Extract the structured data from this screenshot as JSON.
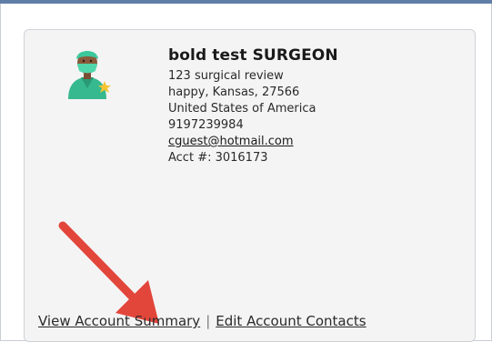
{
  "contact": {
    "name": "bold test SURGEON",
    "address": "123 surgical review",
    "city_state_zip": "happy, Kansas, 27566",
    "country": "United States of America",
    "phone": "9197239984",
    "email": "cguest@hotmail.com",
    "account": "Acct #: 3016173"
  },
  "links": {
    "view_summary": "View Account Summary",
    "separator": "|",
    "edit_contacts": "Edit Account Contacts"
  },
  "icons": {
    "avatar": "surgeon-avatar-icon",
    "annotation": "red-arrow-icon"
  },
  "colors": {
    "arrow": "#e2463a",
    "scrubs": "#36b98e",
    "skin": "#8a5a3c",
    "star": "#f4c430",
    "top_bar": "#5f7fa6"
  }
}
